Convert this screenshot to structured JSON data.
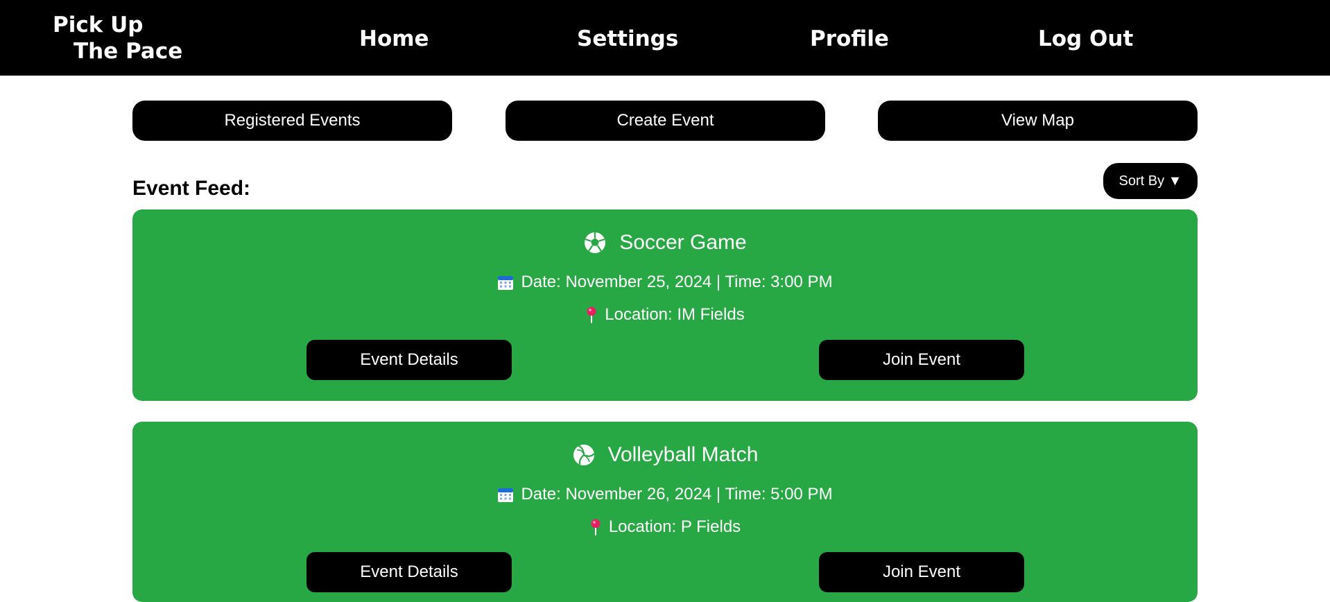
{
  "header": {
    "logo_line1": "Pick Up",
    "logo_line2": "The Pace",
    "nav": [
      {
        "label": "Home"
      },
      {
        "label": "Settings"
      },
      {
        "label": "Profile"
      },
      {
        "label": "Log Out"
      }
    ]
  },
  "actions": {
    "registered_events": "Registered Events",
    "create_event": "Create Event",
    "view_map": "View Map"
  },
  "feed": {
    "title": "Event Feed:",
    "sort_label": "Sort By ▼",
    "events": [
      {
        "icon": "soccer-ball-icon",
        "title": "Soccer Game",
        "date_time": "Date: November 25, 2024 | Time: 3:00 PM",
        "location": "Location: IM Fields",
        "details_label": "Event Details",
        "join_label": "Join Event"
      },
      {
        "icon": "volleyball-icon",
        "title": "Volleyball Match",
        "date_time": "Date: November 26, 2024 | Time: 5:00 PM",
        "location": "Location: P Fields",
        "details_label": "Event Details",
        "join_label": "Join Event"
      }
    ]
  },
  "colors": {
    "header_bg": "#000000",
    "card_bg": "#28a745",
    "button_bg": "#000000",
    "text_light": "#ffffff",
    "pin": "#e91e63",
    "calendar": "#1e6bd6"
  }
}
